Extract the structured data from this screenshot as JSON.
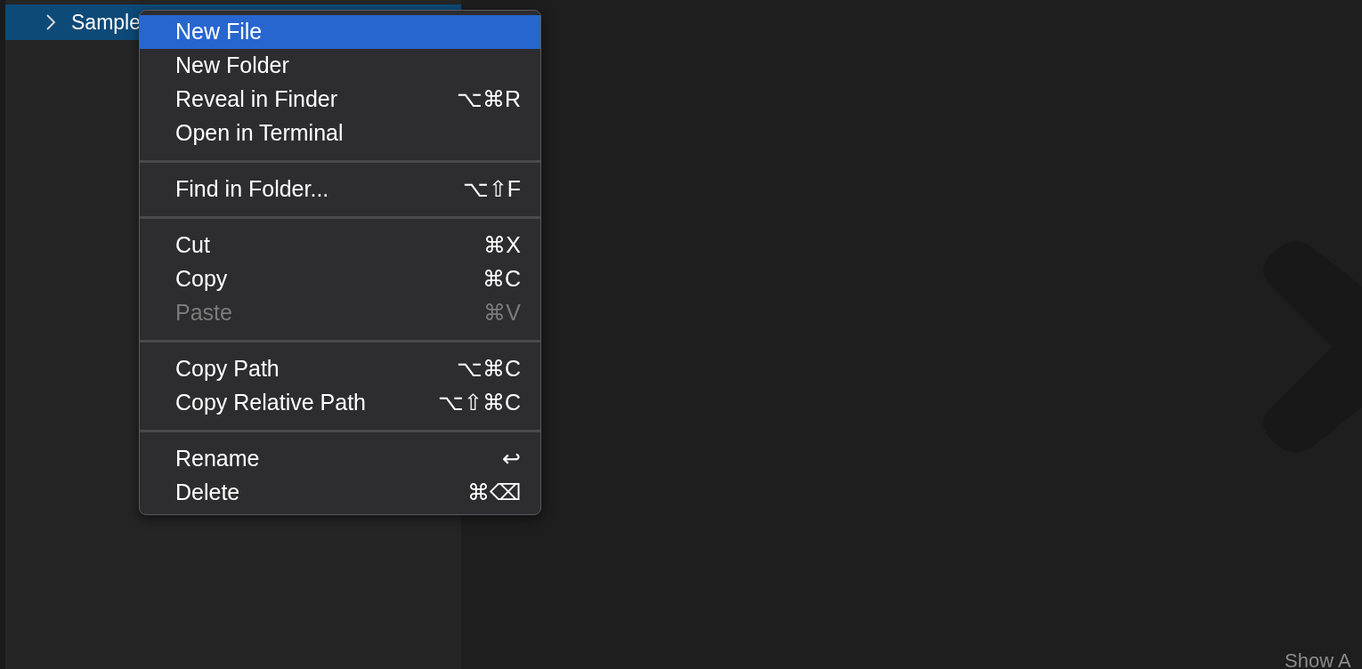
{
  "explorer": {
    "items": [
      {
        "label": "Sample",
        "expanded": false,
        "selected": true
      }
    ]
  },
  "context_menu": {
    "groups": [
      [
        {
          "label": "New File",
          "selected": true,
          "disabled": false
        },
        {
          "label": "New Folder",
          "selected": false,
          "disabled": false
        },
        {
          "label": "Reveal in Finder",
          "shortcut": "⌥⌘R",
          "selected": false,
          "disabled": false
        },
        {
          "label": "Open in Terminal",
          "selected": false,
          "disabled": false
        }
      ],
      [
        {
          "label": "Find in Folder...",
          "shortcut": "⌥⇧F",
          "selected": false,
          "disabled": false
        }
      ],
      [
        {
          "label": "Cut",
          "shortcut": "⌘X",
          "selected": false,
          "disabled": false
        },
        {
          "label": "Copy",
          "shortcut": "⌘C",
          "selected": false,
          "disabled": false
        },
        {
          "label": "Paste",
          "shortcut": "⌘V",
          "selected": false,
          "disabled": true
        }
      ],
      [
        {
          "label": "Copy Path",
          "shortcut": "⌥⌘C",
          "selected": false,
          "disabled": false
        },
        {
          "label": "Copy Relative Path",
          "shortcut": "⌥⇧⌘C",
          "selected": false,
          "disabled": false
        }
      ],
      [
        {
          "label": "Rename",
          "shortcut": "↩",
          "selected": false,
          "disabled": false
        },
        {
          "label": "Delete",
          "shortcut": "⌘⌫",
          "selected": false,
          "disabled": false
        }
      ]
    ]
  },
  "editor": {
    "hint": "Show A"
  }
}
